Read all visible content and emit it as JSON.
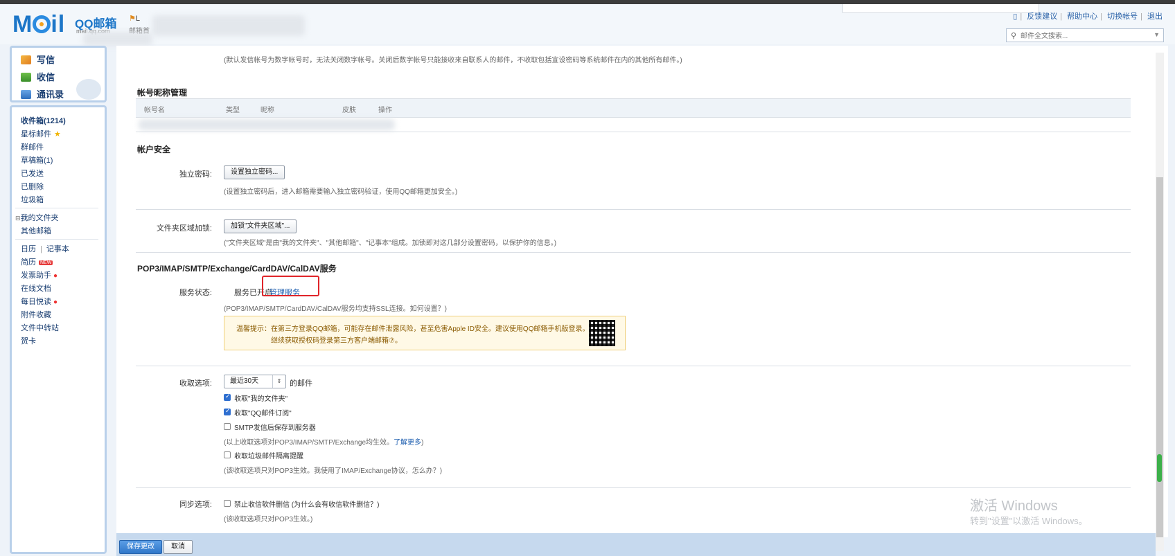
{
  "header": {
    "brand": "Mail",
    "product": "QQ邮箱",
    "product_sub": "mail.qq.com",
    "user_initial": "L",
    "user_sub": "邮箱首",
    "links": [
      "反馈建议",
      "帮助中心",
      "切换帐号",
      "退出"
    ],
    "search_placeholder": "邮件全文搜索..."
  },
  "sidebar": {
    "primary": [
      "写信",
      "收信",
      "通讯录"
    ],
    "folders": [
      {
        "label": "收件箱(1214)",
        "bold": true
      },
      {
        "label": "星标邮件",
        "star": true
      },
      {
        "label": "群邮件"
      },
      {
        "label": "草稿箱(1)"
      },
      {
        "label": "已发送"
      },
      {
        "label": "已删除"
      },
      {
        "label": "垃圾箱"
      }
    ],
    "my_folders": "我的文件夹",
    "other_mail": "其他邮箱",
    "calendar": "日历",
    "notes": "记事本",
    "tools": [
      {
        "label": "简历",
        "badge": "NEW"
      },
      {
        "label": "发票助手",
        "dot": true
      },
      {
        "label": "在线文档"
      },
      {
        "label": "每日悦读",
        "dot": true
      },
      {
        "label": "附件收藏"
      },
      {
        "label": "文件中转站"
      },
      {
        "label": "贺卡"
      }
    ]
  },
  "content": {
    "top_note": "(默认发信帐号为数字帐号时，无法关闭数字帐号。关闭后数字帐号只能接收来自联系人的邮件，不收取包括宣设密码等系统邮件在内的其他所有邮件。)",
    "nickname_section": "帐号昵称管理",
    "table_headers": [
      "帐号名",
      "类型",
      "昵称",
      "皮肤",
      "操作"
    ],
    "security_section": "帐户安全",
    "standalone_pw_label": "独立密码:",
    "standalone_pw_button": "设置独立密码...",
    "standalone_pw_note": "(设置独立密码后，进入邮箱需要输入独立密码验证，使用QQ邮箱更加安全。)",
    "folder_lock_label": "文件夹区域加锁:",
    "folder_lock_button": "加锁\"文件夹区域\"...",
    "folder_lock_note": "(\"文件夹区域\"是由\"我的文件夹\"、\"其他邮箱\"、\"记事本\"组成。加锁即对这几部分设置密码，以保护你的信息。)",
    "service_section": "POP3/IMAP/SMTP/Exchange/CardDAV/CalDAV服务",
    "service_status_label": "服务状态:",
    "service_status_value": "服务已开启",
    "manage_service": "管理服务",
    "ssl_note": "(POP3/IMAP/SMTP/CardDAV/CalDAV服务均支持SSL连接。如何设置？)",
    "tip_line1": "温馨提示：在第三方登录QQ邮箱，可能存在邮件泄露风险，甚至危害Apple ID安全。建议使用QQ邮箱手机版登录。",
    "tip_line2": "继续获取授权码登录第三方客户端邮箱⑦。",
    "receive_label": "收取选项:",
    "receive_select": "最近30天",
    "receive_suffix": "的邮件",
    "receive_options": [
      {
        "label": "收取\"我的文件夹\"",
        "checked": true
      },
      {
        "label": "收取\"QQ邮件订阅\"",
        "checked": true
      },
      {
        "label": "SMTP发信后保存到服务器",
        "checked": false
      }
    ],
    "receive_note": "(以上收取选项对POP3/IMAP/SMTP/Exchange均生效。",
    "learn_more": "了解更多",
    "receive_note_end": ")",
    "spam_option": {
      "label": "收取垃圾邮件隔离提醒",
      "checked": false
    },
    "spam_note": "(该收取选项只对POP3生效。我使用了IMAP/Exchange协议，怎么办？)",
    "sync_label": "同步选项:",
    "sync_option": {
      "label": "禁止收信软件删信",
      "checked": false
    },
    "sync_option_note": "(为什么会有收信软件删信？)",
    "sync_note": "(该收取选项只对POP3生效。)"
  },
  "footer": {
    "save": "保存更改",
    "cancel": "取消"
  },
  "watermark": {
    "line1": "激活 Windows",
    "line2": "转到\"设置\"以激活 Windows。"
  }
}
